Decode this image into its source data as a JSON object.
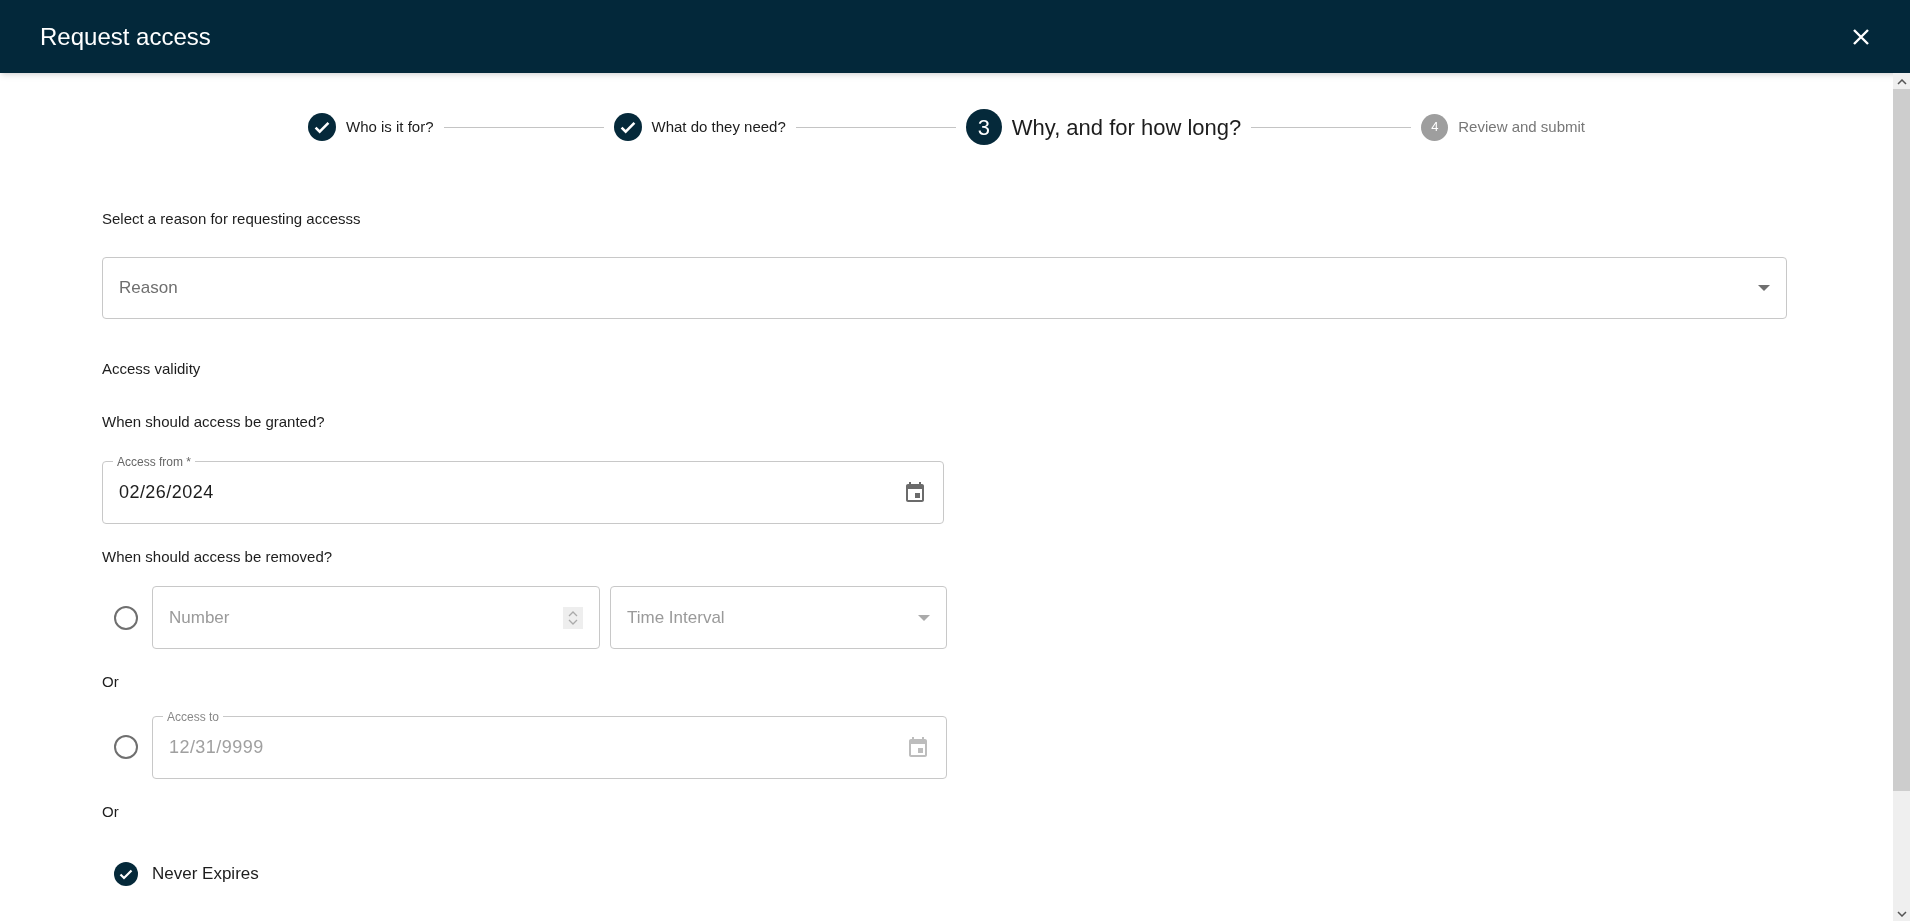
{
  "header": {
    "title": "Request access"
  },
  "stepper": {
    "steps": [
      {
        "label": "Who is it for?",
        "done": true,
        "selected": false
      },
      {
        "label": "What do they need?",
        "done": true,
        "selected": false
      },
      {
        "number": "3",
        "label": "Why, and for how long?",
        "done": false,
        "selected": true
      },
      {
        "number": "4",
        "label": "Review and submit",
        "done": false,
        "selected": false
      }
    ]
  },
  "form": {
    "reason_prompt": "Select a reason for requesting accesss",
    "reason_select": {
      "placeholder": "Reason"
    },
    "section_title": "Access validity",
    "granted_question": "When should access be granted?",
    "access_from": {
      "label": "Access from *",
      "value": "02/26/2024"
    },
    "removed_question": "When should access be removed?",
    "removal_options": [
      {
        "kind": "duration",
        "selected": false,
        "number_placeholder": "Number",
        "interval_placeholder": "Time Interval"
      },
      {
        "kind": "or",
        "text": "Or"
      },
      {
        "kind": "date",
        "selected": false,
        "label": "Access to",
        "value": "12/31/9999",
        "disabled": true
      },
      {
        "kind": "or",
        "text": "Or"
      },
      {
        "kind": "never",
        "checked": true,
        "label": "Never Expires"
      }
    ]
  }
}
